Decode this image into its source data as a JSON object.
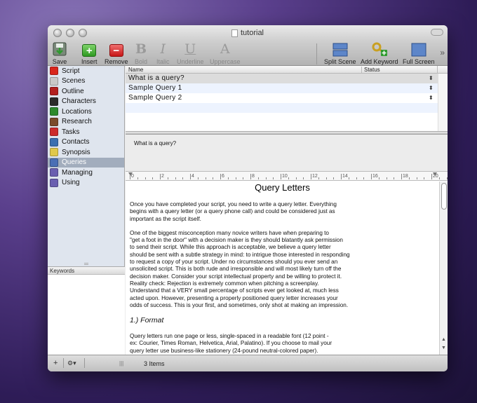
{
  "window": {
    "title": "tutorial"
  },
  "toolbar": {
    "save": "Save",
    "insert": "Insert",
    "remove": "Remove",
    "bold": "Bold",
    "italic": "Italic",
    "underline": "Underline",
    "uppercase": "Uppercase",
    "split_scene": "Split Scene",
    "add_keyword": "Add Keyword",
    "full_screen": "Full Screen",
    "more": "»"
  },
  "sidebar": {
    "items": [
      {
        "label": "Script",
        "icon": "script-icon",
        "color": "#d9261c"
      },
      {
        "label": "Scenes",
        "icon": "scenes-icon",
        "color": "#c9c9c9"
      },
      {
        "label": "Outline",
        "icon": "outline-icon",
        "color": "#b32020"
      },
      {
        "label": "Characters",
        "icon": "characters-icon",
        "color": "#2b2b2b"
      },
      {
        "label": "Locations",
        "icon": "locations-icon",
        "color": "#2d8a2d"
      },
      {
        "label": "Research",
        "icon": "research-icon",
        "color": "#7a4a2a"
      },
      {
        "label": "Tasks",
        "icon": "tasks-icon",
        "color": "#cc2b2b"
      },
      {
        "label": "Contacts",
        "icon": "contacts-icon",
        "color": "#3a6fb0"
      },
      {
        "label": "Synopsis",
        "icon": "synopsis-icon",
        "color": "#e0c84a"
      },
      {
        "label": "Queries",
        "icon": "queries-icon",
        "color": "#4a6fb5"
      },
      {
        "label": "Managing",
        "icon": "managing-icon",
        "color": "#6a5fb0"
      },
      {
        "label": "Using",
        "icon": "using-icon",
        "color": "#6a5fb0"
      }
    ],
    "selected_index": 9,
    "keywords_header": "Keywords"
  },
  "table": {
    "headers": {
      "name": "Name",
      "status": "Status"
    },
    "rows": [
      {
        "name": "What is a query?"
      },
      {
        "name": "Sample Query 1"
      },
      {
        "name": "Sample Query 2"
      }
    ]
  },
  "synopsis_text": "What is a query?",
  "ruler": {
    "labels": [
      "0",
      "2",
      "4",
      "6",
      "8",
      "10",
      "12",
      "14",
      "16",
      "18",
      "20"
    ]
  },
  "editor": {
    "title": "Query Letters",
    "p1": "Once you have completed your script, you need to write a query letter. Everything\nbegins with a query letter (or a query phone call) and could be considered just as\nimportant as the script itself.",
    "p2": "One of the biggest misconception many novice writers have when preparing to\n\"get a foot in the door\" with a decision maker is they should blatantly ask permission\nto send their script. While this approach is acceptable, we believe a query letter\nshould be sent with a subtle strategy in mind: to intrigue those interested in responding\nto request a copy of your script. Under no circumstances should you ever send an\nunsolicited script. This is both rude and irresponsible and will most likely turn off the\ndecision maker. Consider your script intellectual property and be willing to protect it.\nReality check: Rejection is extremely common when pitching a screenplay.\nUnderstand that a VERY small percentage of scripts ever get looked at, much less\nacted upon. However, presenting a properly positioned query letter increases your\nodds of success. This is your first, and sometimes, only shot at making an impression.",
    "h_format": "1.) Format",
    "p3": "Query letters run one page or less, single-spaced in a readable font (12 point -\nex: Courier, Times Roman, Helvetica, Arial, Palatino). If you choose to mail your\nquery letter use business-like stationery (24-pound neutral-colored paper)."
  },
  "statusbar": {
    "add": "+",
    "gear": "⚙▾",
    "count": "3 Items"
  }
}
